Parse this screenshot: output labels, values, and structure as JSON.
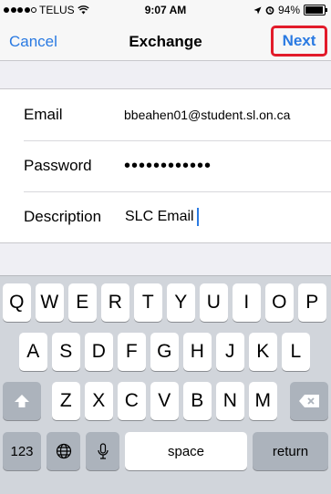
{
  "status_bar": {
    "carrier": "TELUS",
    "time": "9:07 AM",
    "battery_percent": "94%",
    "battery_level": 0.94,
    "icons": [
      "signal-dots",
      "wifi-icon",
      "location-arrow-icon",
      "alarm-icon",
      "battery-icon"
    ]
  },
  "nav": {
    "cancel_label": "Cancel",
    "title": "Exchange",
    "next_label": "Next",
    "next_highlight_color": "#e21b2a"
  },
  "form": {
    "email": {
      "label": "Email",
      "value": "bbeahen01@student.sl.on.ca"
    },
    "password": {
      "label": "Password",
      "value": "••••••••••••"
    },
    "description": {
      "label": "Description",
      "value": "SLC Email"
    }
  },
  "keyboard": {
    "row1": [
      "Q",
      "W",
      "E",
      "R",
      "T",
      "Y",
      "U",
      "I",
      "O",
      "P"
    ],
    "row2": [
      "A",
      "S",
      "D",
      "F",
      "G",
      "H",
      "J",
      "K",
      "L"
    ],
    "row3": [
      "Z",
      "X",
      "C",
      "V",
      "B",
      "N",
      "M"
    ],
    "numbers_label": "123",
    "space_label": "space",
    "return_label": "return",
    "icons": [
      "shift-icon",
      "delete-icon",
      "globe-icon",
      "microphone-icon"
    ]
  },
  "colors": {
    "accent": "#2a7ae2",
    "keyboard_bg": "#d1d5db",
    "dark_key": "#acb3bc"
  }
}
